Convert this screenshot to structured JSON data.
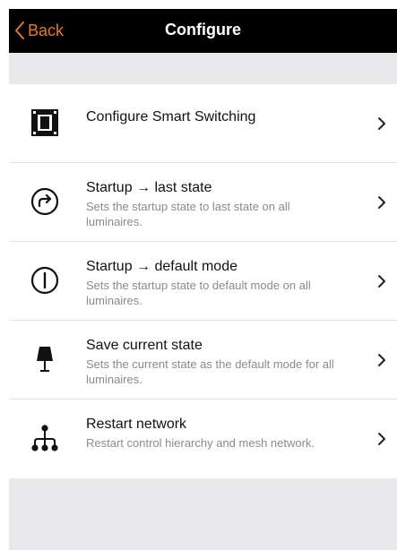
{
  "navbar": {
    "back_label": "Back",
    "title": "Configure",
    "background": "#000000",
    "accent": "#e87a1f"
  },
  "items": [
    {
      "icon": "smart-switch-icon",
      "title": "Configure Smart Switching",
      "subtitle": ""
    },
    {
      "icon": "redo-circle-icon",
      "title": "Startup → last state",
      "subtitle": "Sets the startup state to last state on all luminaires."
    },
    {
      "icon": "power-icon",
      "title": "Startup → default mode",
      "subtitle": "Sets the startup state to default mode on all luminaires."
    },
    {
      "icon": "lamp-icon",
      "title": "Save current state",
      "subtitle": "Sets the current state as the default mode for all luminaires."
    },
    {
      "icon": "network-hierarchy-icon",
      "title": "Restart network",
      "subtitle": "Restart control hierarchy and mesh network."
    }
  ],
  "colors": {
    "page_background": "#e9e9ec",
    "text_primary": "#111111",
    "text_secondary": "#8a8a8f"
  }
}
